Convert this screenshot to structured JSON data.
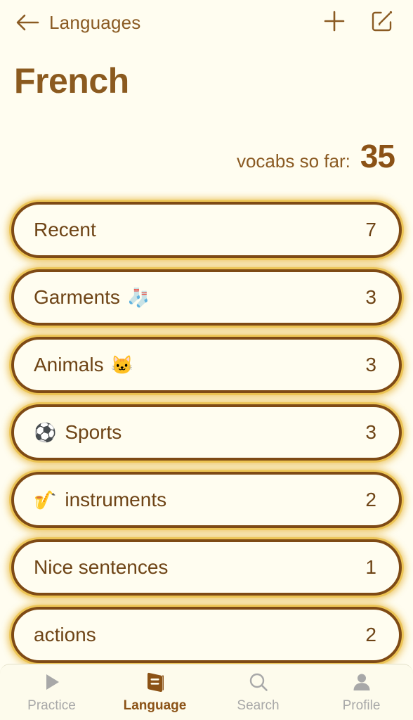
{
  "topbar": {
    "back_icon": "arrow-left-icon",
    "back_label": "Languages",
    "add_icon": "plus-icon",
    "compose_icon": "compose-edit-icon"
  },
  "header": {
    "title": "French"
  },
  "summary": {
    "label": "vocabs so far:",
    "count": "35"
  },
  "categories": [
    {
      "name": "Recent",
      "emoji": "",
      "emoji_position": "none",
      "count": "7"
    },
    {
      "name": "Garments",
      "emoji": "🧦",
      "emoji_position": "trailing",
      "count": "3"
    },
    {
      "name": "Animals",
      "emoji": "🐱",
      "emoji_position": "trailing",
      "count": "3"
    },
    {
      "name": "Sports",
      "emoji": "⚽",
      "emoji_position": "leading",
      "count": "3"
    },
    {
      "name": "instruments",
      "emoji": "🎷",
      "emoji_position": "leading",
      "count": "2"
    },
    {
      "name": "Nice sentences",
      "emoji": "",
      "emoji_position": "none",
      "count": "1"
    },
    {
      "name": "actions",
      "emoji": "",
      "emoji_position": "none",
      "count": "2"
    }
  ],
  "tabbar": {
    "items": [
      {
        "label": "Practice",
        "icon": "play-icon",
        "active": false
      },
      {
        "label": "Language",
        "icon": "book-icon",
        "active": true
      },
      {
        "label": "Search",
        "icon": "search-icon",
        "active": false
      },
      {
        "label": "Profile",
        "icon": "person-icon",
        "active": false
      }
    ]
  },
  "colors": {
    "background": "#FFFDF0",
    "brand_brown": "#7E4A15",
    "text_brown": "#6E4416",
    "title_brown": "#8B5A1F",
    "glow_gold": "#E8B830",
    "inactive_gray": "#A8A8A8"
  }
}
